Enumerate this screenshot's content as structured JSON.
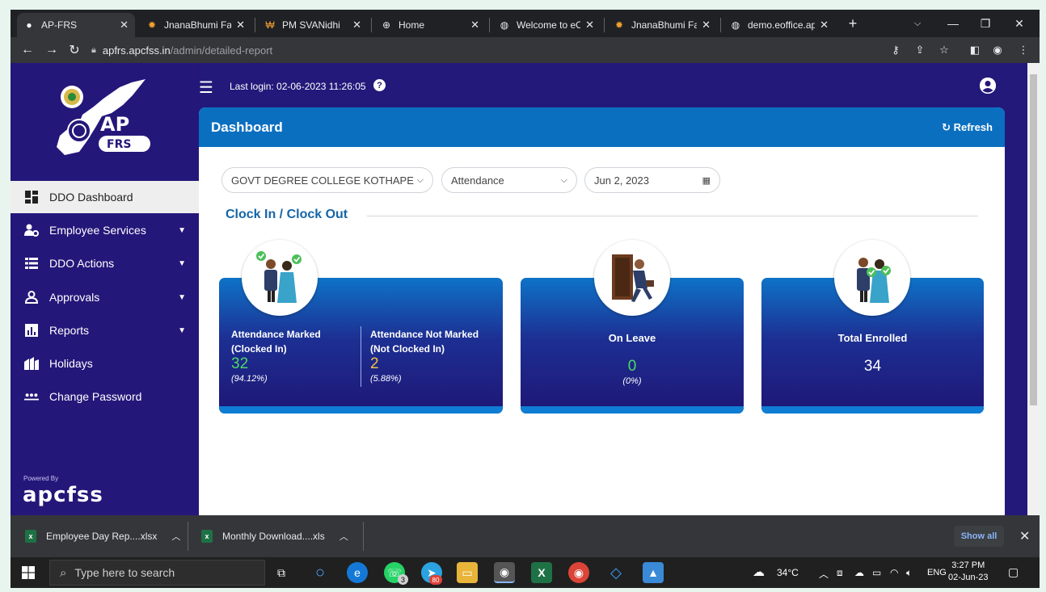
{
  "browser": {
    "tabs": [
      {
        "title": "AP-FRS",
        "icon": "ap-frs-favicon",
        "active": true
      },
      {
        "title": "JnanaBhumi Facia",
        "icon": "jnanabhumi-favicon"
      },
      {
        "title": "PM SVANidhi",
        "icon": "svanidhi-favicon"
      },
      {
        "title": "Home",
        "icon": "home-favicon"
      },
      {
        "title": "Welcome to eOffi",
        "icon": "globe-favicon"
      },
      {
        "title": "JnanaBhumi Facia",
        "icon": "jnanabhumi-favicon"
      },
      {
        "title": "demo.eoffice.ap.",
        "icon": "globe-favicon"
      }
    ],
    "url_host": "apfrs.apcfss.in",
    "url_path": "/admin/detailed-report"
  },
  "app": {
    "last_login": "Last login: 02-06-2023 11:26:05",
    "logo_text_top": "AP",
    "logo_text_bottom": "FRS",
    "powered_by": "Powered By",
    "powered_brand": "apcfss"
  },
  "sidebar": {
    "items": [
      {
        "label": "DDO Dashboard",
        "icon": "dashboard-icon",
        "active": true,
        "caret": false
      },
      {
        "label": "Employee Services",
        "icon": "users-cog-icon",
        "caret": true
      },
      {
        "label": "DDO Actions",
        "icon": "list-icon",
        "caret": true
      },
      {
        "label": "Approvals",
        "icon": "user-check-icon",
        "caret": true
      },
      {
        "label": "Reports",
        "icon": "bar-chart-icon",
        "caret": true
      },
      {
        "label": "Holidays",
        "icon": "buildings-icon",
        "caret": false
      },
      {
        "label": "Change Password",
        "icon": "password-dots-icon",
        "caret": false
      }
    ]
  },
  "dashboard": {
    "title": "Dashboard",
    "refresh_label": "Refresh",
    "filters": {
      "college": "GOVT DEGREE COLLEGE KOTHAPETA",
      "report_type": "Attendance",
      "date": "Jun 2, 2023"
    },
    "section_title": "Clock In / Clock Out",
    "cards": {
      "marked": {
        "label_line1": "Attendance Marked",
        "label_line2": "(Clocked In)",
        "value": "32",
        "percent": "(94.12%)"
      },
      "not_marked": {
        "label_line1": "Attendance Not Marked",
        "label_line2": "(Not Clocked In)",
        "value": "2",
        "percent": "(5.88%)"
      },
      "on_leave": {
        "label": "On Leave",
        "value": "0",
        "percent": "(0%)"
      },
      "total": {
        "label": "Total Enrolled",
        "value": "34"
      }
    },
    "colors": {
      "marked_value": "#4cd964",
      "not_marked_value": "#f5c242",
      "leave_value": "#4cd964"
    }
  },
  "downloads": {
    "items": [
      {
        "name": "Employee Day Rep....xlsx"
      },
      {
        "name": "Monthly Download....xls"
      }
    ],
    "show_all": "Show all"
  },
  "taskbar": {
    "search_placeholder": "Type here to search",
    "weather": "34°C",
    "language": "ENG",
    "time": "3:27 PM",
    "date": "02-Jun-23",
    "whatsapp_badge": "3",
    "telegram_badge": "80"
  }
}
